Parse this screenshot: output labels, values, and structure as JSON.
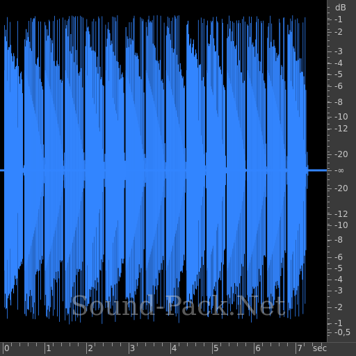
{
  "colors": {
    "background": "#000000",
    "waveform": "#3385ff",
    "ruler_background": "#3a3a3a",
    "ruler_text": "#c8c8c8"
  },
  "db_scale": {
    "unit": "dB",
    "top_labels": [
      "-1",
      "-2",
      "-3",
      "-4",
      "-5",
      "-6",
      "-8",
      "-10",
      "-12",
      "-20"
    ],
    "center_label": "-∞",
    "bottom_labels": [
      "-20",
      "-12",
      "-10",
      "-8",
      "-6",
      "-5",
      "-4",
      "-3",
      "-2",
      "-1",
      "-0,5"
    ]
  },
  "time_scale": {
    "unit": "sec",
    "labels": [
      "0",
      "1",
      "2",
      "3",
      "4",
      "5",
      "6",
      "7"
    ]
  },
  "waveform": {
    "hit_count": 15,
    "duration_sec": 7.6
  },
  "watermark": "Sound-Pack.Net"
}
